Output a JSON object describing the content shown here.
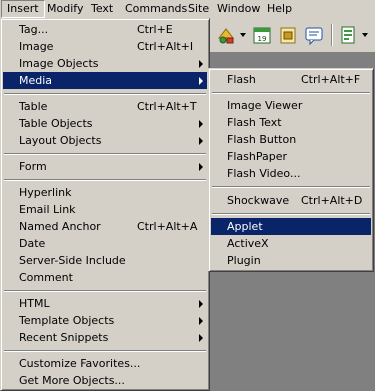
{
  "menubar": {
    "items": [
      {
        "label": "Insert"
      },
      {
        "label": "Modify"
      },
      {
        "label": "Text"
      },
      {
        "label": "Commands"
      },
      {
        "label": "Site"
      },
      {
        "label": "Window"
      },
      {
        "label": "Help"
      }
    ]
  },
  "insert_menu": {
    "items": [
      {
        "label": "Tag...",
        "shortcut": "Ctrl+E"
      },
      {
        "label": "Image",
        "shortcut": "Ctrl+Alt+I"
      },
      {
        "label": "Image Objects"
      },
      {
        "label": "Media"
      },
      {
        "label": "Table",
        "shortcut": "Ctrl+Alt+T"
      },
      {
        "label": "Table Objects"
      },
      {
        "label": "Layout Objects"
      },
      {
        "label": "Form"
      },
      {
        "label": "Hyperlink"
      },
      {
        "label": "Email Link"
      },
      {
        "label": "Named Anchor",
        "shortcut": "Ctrl+Alt+A"
      },
      {
        "label": "Date"
      },
      {
        "label": "Server-Side Include"
      },
      {
        "label": "Comment"
      },
      {
        "label": "HTML"
      },
      {
        "label": "Template Objects"
      },
      {
        "label": "Recent Snippets"
      },
      {
        "label": "Customize Favorites..."
      },
      {
        "label": "Get More Objects..."
      }
    ]
  },
  "media_menu": {
    "items": [
      {
        "label": "Flash",
        "shortcut": "Ctrl+Alt+F"
      },
      {
        "label": "Image Viewer"
      },
      {
        "label": "Flash Text"
      },
      {
        "label": "Flash Button"
      },
      {
        "label": "FlashPaper"
      },
      {
        "label": "Flash Video..."
      },
      {
        "label": "Shockwave",
        "shortcut": "Ctrl+Alt+D"
      },
      {
        "label": "Applet"
      },
      {
        "label": "ActiveX"
      },
      {
        "label": "Plugin"
      }
    ]
  },
  "colors": {
    "menu_bg": "#d4d0c8",
    "highlight": "#0a246a",
    "workspace": "#808080"
  },
  "toolbar": {
    "icons": [
      "asset-icon",
      "calendar-icon",
      "server-include-icon",
      "comment-icon",
      "template-icon"
    ]
  }
}
